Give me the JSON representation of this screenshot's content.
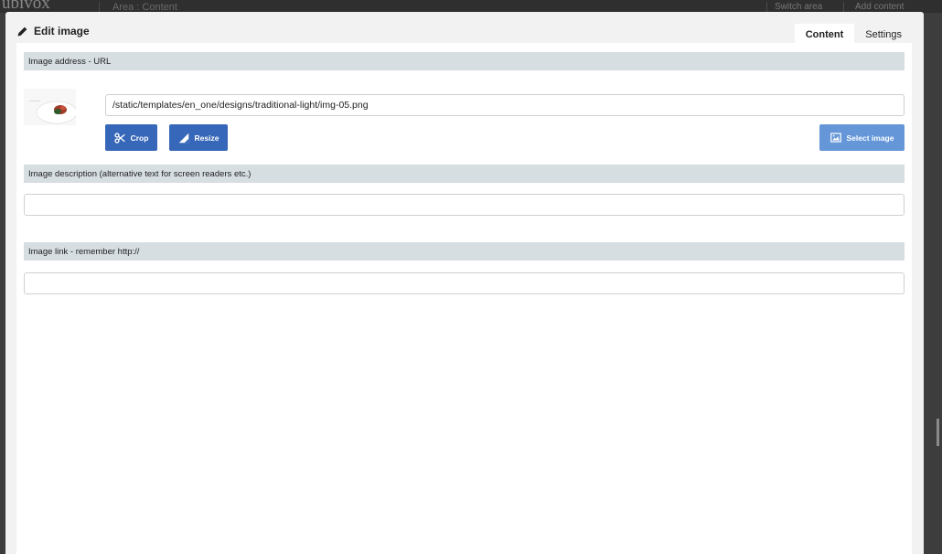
{
  "background": {
    "logo": "ubivox",
    "area_label": "Area : Content",
    "switch_area": "Switch area",
    "add_content": "Add content"
  },
  "modal": {
    "title": "Edit image",
    "tabs": [
      {
        "label": "Content",
        "active": true
      },
      {
        "label": "Settings",
        "active": false
      }
    ]
  },
  "image_address": {
    "label": "Image address - URL",
    "value": "/static/templates/en_one/designs/traditional-light/img-05.png",
    "crop_label": "Crop",
    "resize_label": "Resize",
    "select_label": "Select image"
  },
  "image_description": {
    "label": "Image description (alternative text for screen readers etc.)",
    "value": "",
    "placeholder": ""
  },
  "image_link": {
    "label": "Image link - remember http://",
    "value": "",
    "placeholder": ""
  },
  "colors": {
    "primary_button": "#3767b8",
    "secondary_button": "#6496d8",
    "section_bar": "#d6dee2"
  },
  "icons": {
    "title": "pencil-icon",
    "crop": "scissors-icon",
    "resize": "resize-icon",
    "select": "image-icon"
  }
}
